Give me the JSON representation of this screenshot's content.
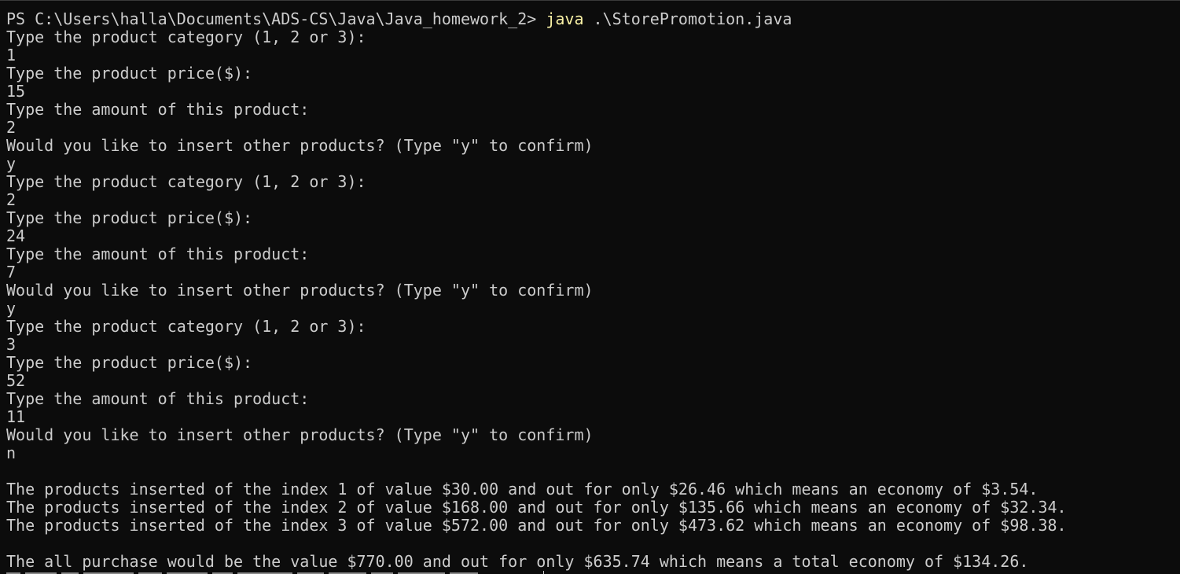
{
  "terminal": {
    "prompt": {
      "path": "PS C:\\Users\\halla\\Documents\\ADS-CS\\Java\\Java_homework_2> ",
      "command": "java",
      "args": " .\\StorePromotion.java"
    },
    "lines": [
      "Type the product category (1, 2 or 3):",
      "1",
      "Type the product price($):",
      "15",
      "Type the amount of this product:",
      "2",
      "Would you like to insert other products? (Type \"y\" to confirm)",
      "y",
      "Type the product category (1, 2 or 3):",
      "2",
      "Type the product price($):",
      "24",
      "Type the amount of this product:",
      "7",
      "Would you like to insert other products? (Type \"y\" to confirm)",
      "y",
      "Type the product category (1, 2 or 3):",
      "3",
      "Type the product price($):",
      "52",
      "Type the amount of this product:",
      "11",
      "Would you like to insert other products? (Type \"y\" to confirm)",
      "n",
      "",
      "The products inserted of the index 1 of value $30.00 and out for only $26.46 which means an economy of $3.54.",
      "The products inserted of the index 2 of value $168.00 and out for only $135.66 which means an economy of $32.34.",
      "The products inserted of the index 3 of value $572.00 and out for only $473.62 which means an economy of $98.38.",
      "",
      "The all purchase would be the value $770.00 and out for only $635.74 which means a total economy of $134.26."
    ]
  },
  "colors": {
    "background": "#0c0c0c",
    "foreground": "#cccccc",
    "command_highlight": "#f9f1a5"
  }
}
